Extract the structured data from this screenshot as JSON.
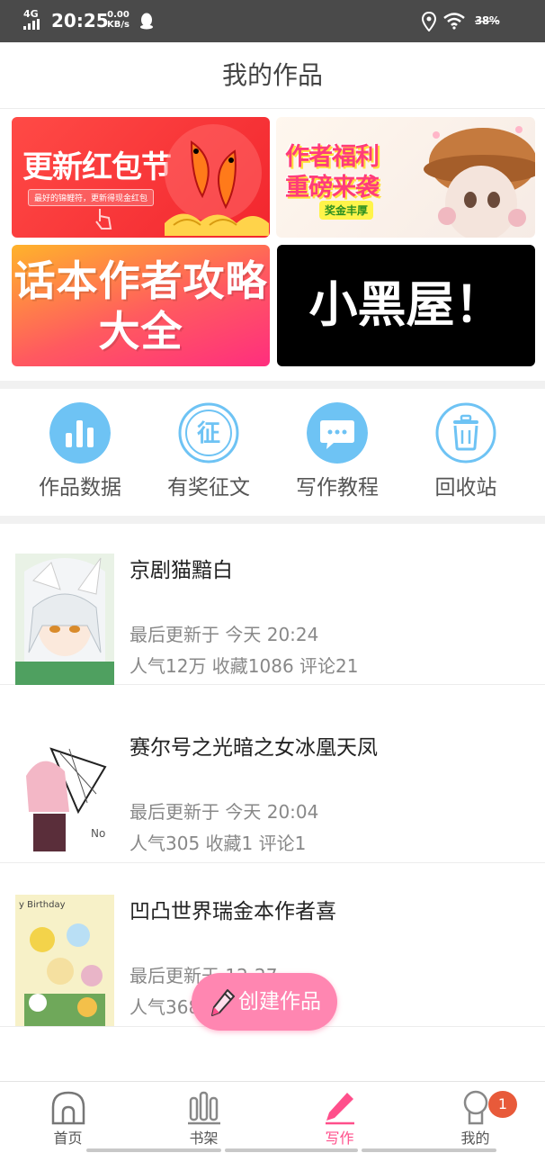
{
  "status_bar": {
    "network": "4G",
    "time": "20:25",
    "speed_value": "0.00",
    "speed_unit": "KB/s",
    "battery": "38%",
    "icons": [
      "signal-icon",
      "qq-icon",
      "location-icon",
      "wifi-icon",
      "battery-icon"
    ]
  },
  "header": {
    "title": "我的作品"
  },
  "banners": [
    {
      "title": "更新红包节",
      "subtitle": "最好的锦鲤符，更新得现金红包"
    },
    {
      "title_line1": "作者福利",
      "title_line2": "重磅来袭",
      "badge": "奖金丰厚"
    },
    {
      "title_line1": "话本作者攻略",
      "title_line2": "大全"
    },
    {
      "title": "小黑屋！"
    }
  ],
  "quick_actions": [
    {
      "label": "作品数据",
      "icon": "bar-chart-icon"
    },
    {
      "label": "有奖征文",
      "icon": "zheng-icon"
    },
    {
      "label": "写作教程",
      "icon": "chat-bubble-icon"
    },
    {
      "label": "回收站",
      "icon": "trash-icon"
    }
  ],
  "works": [
    {
      "title": "京剧猫黯白",
      "updated": "最后更新于 今天 20:24",
      "stats": "人气12万  收藏1086  评论21"
    },
    {
      "title": "赛尔号之光暗之女冰凰天凤",
      "updated": "最后更新于 今天 20:04",
      "stats": "人气305  收藏1  评论1"
    },
    {
      "title": "凹凸世界瑞金本作者喜",
      "updated": "最后更新于 12-27",
      "stats": "人气368"
    }
  ],
  "fab": {
    "label": "创建作品",
    "icon": "pencil-icon"
  },
  "bottom_nav": [
    {
      "label": "首页",
      "icon": "home-icon"
    },
    {
      "label": "书架",
      "icon": "bookshelf-icon"
    },
    {
      "label": "写作",
      "icon": "write-icon",
      "active": true
    },
    {
      "label": "我的",
      "icon": "profile-icon",
      "badge": "1"
    }
  ],
  "colors": {
    "accent": "#ff4f8b",
    "icon_blue": "#6ec3f4",
    "fab": "#ff86b1",
    "badge": "#e85a3a"
  }
}
